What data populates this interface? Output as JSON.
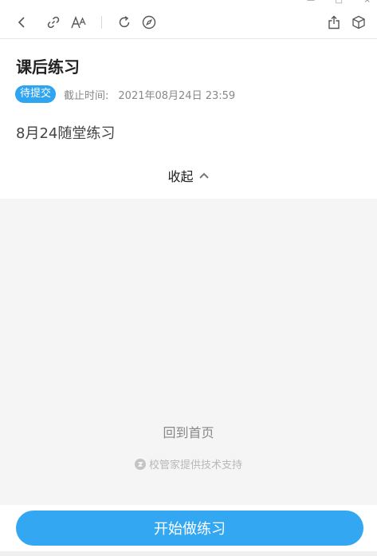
{
  "window": {
    "min_glyph": "—",
    "max_glyph": "□",
    "close_glyph": "×"
  },
  "toolbar": {
    "icons": [
      "back-icon",
      "link-icon",
      "font-size-icon",
      "refresh-icon",
      "compass-icon",
      "share-icon",
      "cube-icon"
    ]
  },
  "task": {
    "title": "课后练习",
    "status_badge": "待提交",
    "deadline_label": "截止时间:",
    "deadline_value": "2021年08月24日 23:59",
    "description": "8月24随堂练习",
    "collapse_label": "收起"
  },
  "footer": {
    "home_link": "回到首页",
    "powered_by": "校管家提供技术支持"
  },
  "action": {
    "start_label": "开始做练习"
  },
  "colors": {
    "accent": "#34a7f2",
    "badge": "#2fa4f0",
    "panel_bg": "#f5f5f5"
  }
}
